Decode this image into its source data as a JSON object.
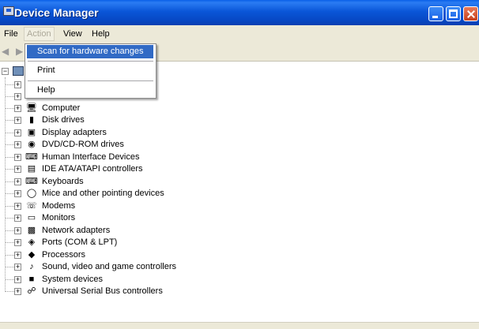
{
  "window": {
    "title": "Device Manager"
  },
  "menubar": {
    "file": "File",
    "action": "Action",
    "view": "View",
    "help": "Help"
  },
  "toolbar": {
    "back_icon": "back-arrow-icon",
    "forward_icon": "forward-arrow-icon"
  },
  "action_menu": {
    "items": [
      {
        "label": "Scan for hardware changes",
        "selected": true
      },
      {
        "label": "Print",
        "selected": false
      },
      {
        "label": "Help",
        "selected": false
      }
    ]
  },
  "tree": {
    "expander_collapsed": "+",
    "expander_expanded": "−",
    "items": [
      {
        "label": "",
        "icon": "computer-icon"
      },
      {
        "label": "Computer",
        "icon": "computer-icon"
      },
      {
        "label": "Disk drives",
        "icon": "disk-drive-icon"
      },
      {
        "label": "Display adapters",
        "icon": "display-adapter-icon"
      },
      {
        "label": "DVD/CD-ROM drives",
        "icon": "dvd-drive-icon"
      },
      {
        "label": "Human Interface Devices",
        "icon": "hid-icon"
      },
      {
        "label": "IDE ATA/ATAPI controllers",
        "icon": "ide-controller-icon"
      },
      {
        "label": "Keyboards",
        "icon": "keyboard-icon"
      },
      {
        "label": "Mice and other pointing devices",
        "icon": "mouse-icon"
      },
      {
        "label": "Modems",
        "icon": "modem-icon"
      },
      {
        "label": "Monitors",
        "icon": "monitor-icon"
      },
      {
        "label": "Network adapters",
        "icon": "network-adapter-icon"
      },
      {
        "label": "Ports (COM & LPT)",
        "icon": "port-icon"
      },
      {
        "label": "Processors",
        "icon": "processor-icon"
      },
      {
        "label": "Sound, video and game controllers",
        "icon": "sound-icon"
      },
      {
        "label": "System devices",
        "icon": "system-device-icon"
      },
      {
        "label": "Universal Serial Bus controllers",
        "icon": "usb-icon"
      }
    ]
  },
  "colors": {
    "titlebar": "#0a56d8",
    "menu_highlight": "#316ac5",
    "chrome": "#ece9d8"
  }
}
